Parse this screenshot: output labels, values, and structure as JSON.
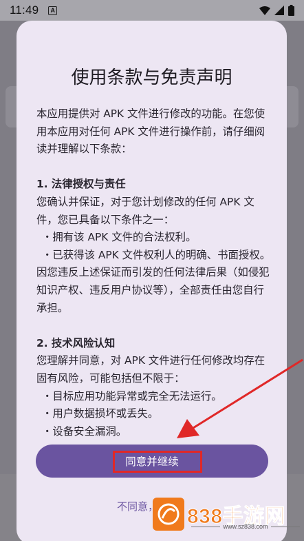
{
  "status_bar": {
    "time": "11:49",
    "notification_icon_letter": "A"
  },
  "dialog": {
    "title": "使用条款与免责声明",
    "intro": "本应用提供对 APK 文件进行修改的功能。在您使用本应用对任何 APK 文件进行操作前，请仔细阅读并理解以下条款：",
    "section1": {
      "heading": "1. 法律授权与责任",
      "text": "您确认并保证，对于您计划修改的任何 APK 文件，您已具备以下条件之一：",
      "items": [
        "・拥有该 APK 文件的合法权利。",
        "・已获得该 APK 文件权利人的明确、书面授权。"
      ],
      "closing": "因您违反上述保证而引发的任何法律后果（如侵犯知识产权、违反用户协议等），全部责任由您自行承担。"
    },
    "section2": {
      "heading": "2. 技术风险认知",
      "text": "您理解并同意，对 APK 文件进行任何修改均存在固有风险，可能包括但不限于：",
      "items": [
        "・目标应用功能异常或完全无法运行。",
        "・用户数据损坏或丢失。",
        "・设备安全漏洞。"
      ]
    },
    "agree_button_label": "同意并继续",
    "decline_label": "不同意，退出"
  },
  "watermark": {
    "brand": "838手游网",
    "url": "www.sz838.com"
  },
  "colors": {
    "accent": "#6a54a0",
    "dialog_bg": "#ede6f3",
    "highlight": "#e02828",
    "watermark": "#f07a1c"
  }
}
